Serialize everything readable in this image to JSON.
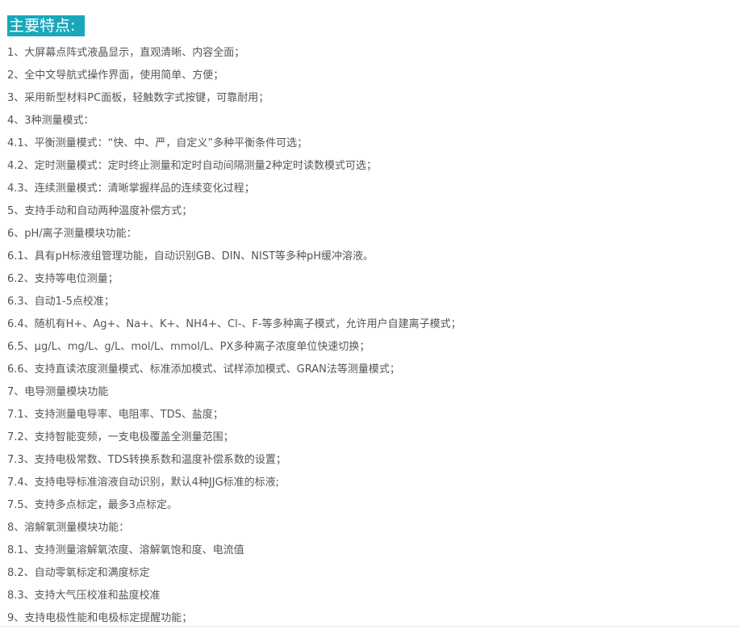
{
  "section": {
    "title": "主要特点:"
  },
  "features": [
    "1、大屏幕点阵式液晶显示，直观清晰、内容全面；",
    "2、全中文导航式操作界面，使用简单、方便；",
    "3、采用新型材料PC面板，轻触数字式按键，可靠耐用；",
    "4、3种测量模式：",
    "4.1、平衡测量模式：“快、中、严，自定义”多种平衡条件可选；",
    "4.2、定时测量模式：定时终止测量和定时自动间隔测量2种定时读数模式可选；",
    "4.3、连续测量模式：清晰掌握样品的连续变化过程；",
    "5、支持手动和自动两种温度补偿方式；",
    "6、pH/离子测量模块功能：",
    "6.1、具有pH标液组管理功能，自动识别GB、DIN、NIST等多种pH缓冲溶液。",
    "6.2、支持等电位测量；",
    "6.3、自动1-5点校准；",
    "6.4、随机有H+、Ag+、Na+、K+、NH4+、Cl-、F-等多种离子模式，允许用户自建离子模式；",
    "6.5、µg/L、mg/L、g/L、mol/L、mmol/L、PX多种离子浓度单位快速切换；",
    "6.6、支持直读浓度测量模式、标准添加模式、试样添加模式、GRAN法等测量模式；",
    "7、电导测量模块功能",
    "7.1、支持测量电导率、电阻率、TDS、盐度；",
    "7.2、支持智能变频，一支电极覆盖全测量范围；",
    "7.3、支持电极常数、TDS转换系数和温度补偿系数的设置；",
    "7.4、支持电导标准溶液自动识别，默认4种JJG标准的标液;",
    "7.5、支持多点标定，最多3点标定。",
    "8、溶解氧测量模块功能：",
    "8.1、支持测量溶解氧浓度、溶解氧饱和度、电流值",
    "8.2、自动零氧标定和满度标定",
    "8.3、支持大气压校准和盐度校准",
    "9、支持电极性能和电极标定提醒功能；"
  ]
}
